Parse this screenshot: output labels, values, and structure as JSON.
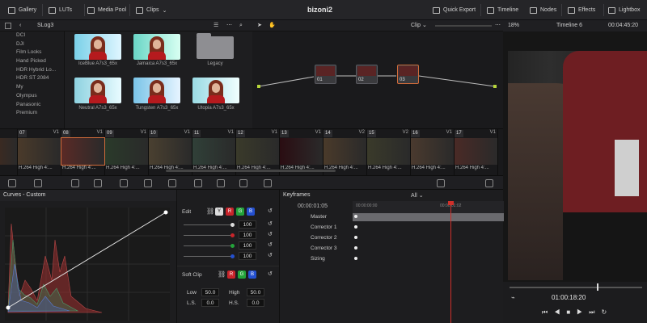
{
  "topbar": {
    "gallery": "Gallery",
    "luts": "LUTs",
    "media_pool": "Media Pool",
    "clips": "Clips",
    "project_title": "bizoni2",
    "quick_export": "Quick Export",
    "timeline": "Timeline",
    "nodes": "Nodes",
    "effects": "Effects",
    "lightbox": "Lightbox"
  },
  "subbar": {
    "lut_folder": "SLog3",
    "clip_mode": "Clip",
    "zoom": "18%",
    "timeline_name": "Timeline 6",
    "timecode": "00:04:45:20"
  },
  "lut_list": [
    "DCI",
    "DJI",
    "Film Looks",
    "Hand Picked",
    "HDR Hybrid Lo...",
    "HDR ST 2084",
    "My",
    "Olympus",
    "Panasonic",
    "Premium"
  ],
  "lut_thumbs": [
    {
      "label": "IceBlue A7s3_65x"
    },
    {
      "label": "Jamaica A7s3_65x"
    },
    {
      "label": "Legacy"
    },
    {
      "label": "Neutral A7s3_65x"
    },
    {
      "label": "Tungsten A7s3_65x"
    },
    {
      "label": "Utopia A7s3_65x"
    }
  ],
  "nodes": [
    {
      "label": "01"
    },
    {
      "label": "02"
    },
    {
      "label": "03"
    }
  ],
  "clips": [
    {
      "num": "",
      "track": "",
      "caption": ""
    },
    {
      "num": "07",
      "track": "V1",
      "caption": "H.264 High 4:..."
    },
    {
      "num": "08",
      "track": "V1",
      "caption": "H.264 High 4:..."
    },
    {
      "num": "09",
      "track": "V1",
      "caption": "H.264 High 4:..."
    },
    {
      "num": "10",
      "track": "V1",
      "caption": "H.264 High 4:..."
    },
    {
      "num": "11",
      "track": "V1",
      "caption": "H.264 High 4:..."
    },
    {
      "num": "12",
      "track": "V1",
      "caption": "H.264 High 4:..."
    },
    {
      "num": "13",
      "track": "V1",
      "caption": "H.264 High 4:..."
    },
    {
      "num": "14",
      "track": "V2",
      "caption": "H.264 High 4:..."
    },
    {
      "num": "15",
      "track": "V2",
      "caption": "H.264 High 4:..."
    },
    {
      "num": "16",
      "track": "V1",
      "caption": "H.264 High 4:..."
    },
    {
      "num": "17",
      "track": "V1",
      "caption": "H.264 High 4:..."
    }
  ],
  "curves": {
    "title": "Curves - Custom"
  },
  "edit": {
    "label": "Edit",
    "y": "Y",
    "r": "R",
    "g": "G",
    "b": "B",
    "values": [
      "100",
      "100",
      "100",
      "100"
    ],
    "soft_clip": "Soft Clip",
    "low_label": "Low",
    "low_value": "50.0",
    "high_label": "High",
    "high_value": "50.0",
    "ls_label": "L.S.",
    "ls_value": "0.0",
    "hs_label": "H.S.",
    "hs_value": "0.0"
  },
  "keyframes": {
    "title": "Keyframes",
    "filter": "All",
    "timecode": "00:00:01:05",
    "ruler_start": "00:00:00:00",
    "ruler_mid": "00:00:01:02",
    "rows": [
      "Master",
      "Corrector 1",
      "Corrector 2",
      "Corrector 3",
      "Sizing"
    ]
  },
  "viewer": {
    "playhead_timecode": "01:00:18:20"
  },
  "colors": {
    "accent": "#d06b3a",
    "red": "#c8242a",
    "green": "#23a33a",
    "blue": "#2450d0"
  }
}
